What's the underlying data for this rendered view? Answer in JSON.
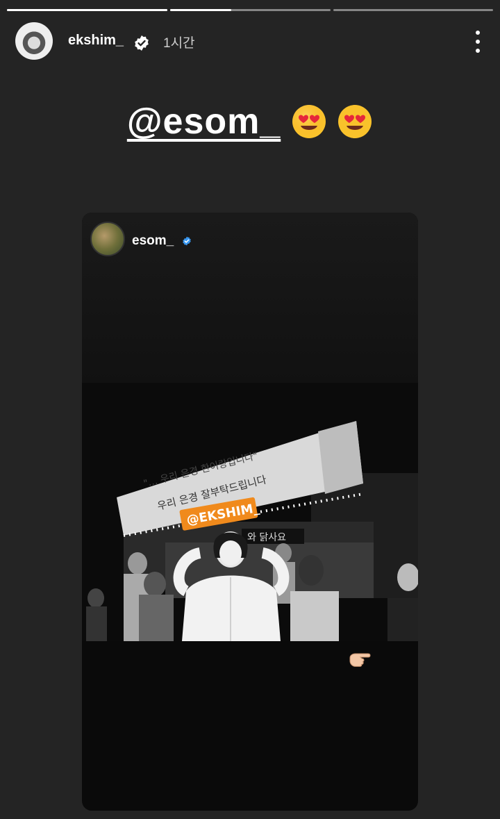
{
  "story": {
    "progress": [
      1.0,
      0.38,
      0.0,
      0.0
    ]
  },
  "header": {
    "username": "ekshim_",
    "time": "1시간",
    "avatar_icon": "profile-avatar",
    "verified_icon": "verified-badge-icon",
    "more_icon": "more-vertical-icon"
  },
  "mention": {
    "text": "@esom_",
    "emoji": [
      "heart-eyes-emoji",
      "heart-eyes-emoji"
    ]
  },
  "shared_post": {
    "username": "esom_",
    "verified_icon": "verified-badge-icon",
    "photo": {
      "banner_line1": "\"… 우리 은경 한이랑입니다\"",
      "banner_line2": "우리 은경 잘부탁드립니다",
      "tag": "@EKSHIM_",
      "sign": "와 닭사요"
    },
    "pointing_emoji": "pointing-hand-emoji"
  },
  "colors": {
    "background": "#242424",
    "card": "#0a0a0a",
    "verified_blue": "#3897f0",
    "tag_orange": "#f08a1c"
  }
}
